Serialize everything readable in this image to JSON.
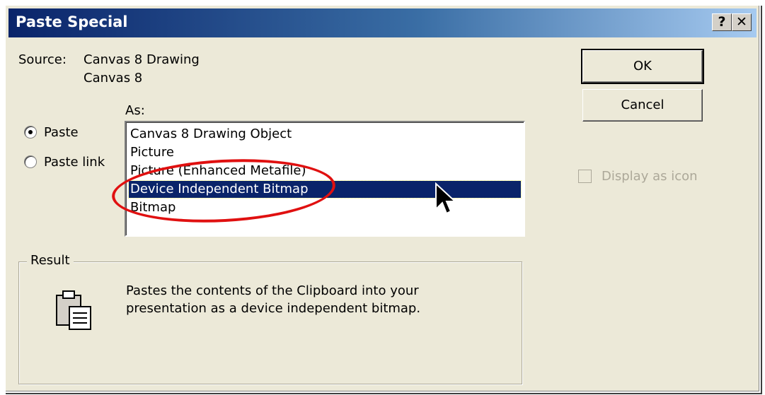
{
  "dialog": {
    "title": "Paste Special",
    "help_button": "?",
    "close_button": "✕"
  },
  "source": {
    "label": "Source:",
    "line1": "Canvas 8 Drawing",
    "line2": "Canvas 8"
  },
  "as_label": "As:",
  "options": {
    "paste": "Paste",
    "paste_link": "Paste link",
    "selected": "Paste"
  },
  "formats": [
    "Canvas 8 Drawing Object",
    "Picture",
    "Picture (Enhanced Metafile)",
    "Device Independent Bitmap",
    "Bitmap"
  ],
  "selected_format": "Device Independent Bitmap",
  "buttons": {
    "ok": "OK",
    "cancel": "Cancel"
  },
  "display_as_icon": {
    "label": "Display as icon",
    "checked": false,
    "enabled": false
  },
  "result": {
    "legend": "Result",
    "text": "Pastes the contents of the Clipboard into your presentation as a device independent bitmap.",
    "icon": "clipboard-paste-icon"
  },
  "annotation": {
    "highlight_color": "#e01010"
  },
  "colors": {
    "title_bar": "#0a246a",
    "selection": "#0a246a",
    "dialog_bg": "#ece9d8"
  }
}
